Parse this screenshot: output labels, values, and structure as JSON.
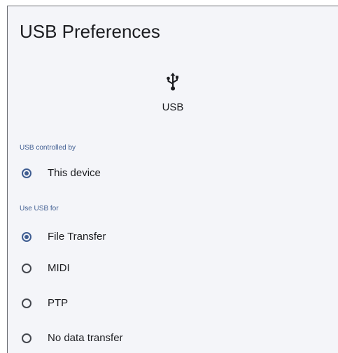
{
  "header": {
    "title": "USB Preferences"
  },
  "usb": {
    "icon": "usb-icon",
    "label": "USB"
  },
  "controlled_by": {
    "heading": "USB controlled by",
    "options": [
      {
        "label": "This device",
        "selected": true
      }
    ]
  },
  "use_for": {
    "heading": "Use USB for",
    "options": [
      {
        "label": "File Transfer",
        "selected": true
      },
      {
        "label": "MIDI",
        "selected": false
      },
      {
        "label": "PTP",
        "selected": false
      },
      {
        "label": "No data transfer",
        "selected": false
      }
    ]
  },
  "colors": {
    "accent": "#3f5d91",
    "background": "#f4f5f9",
    "text": "#1c1d21"
  }
}
